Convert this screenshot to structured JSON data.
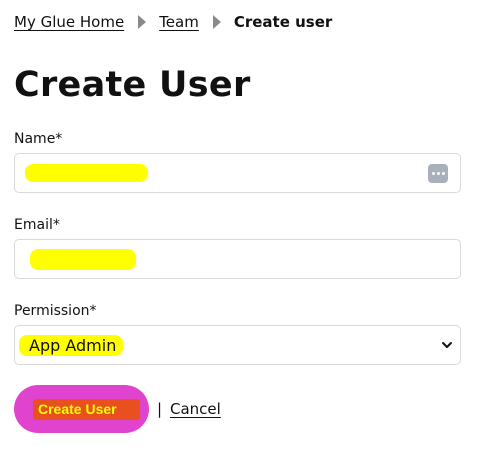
{
  "breadcrumb": {
    "home": "My Glue Home",
    "team": "Team",
    "current": "Create user"
  },
  "page": {
    "title": "Create User"
  },
  "form": {
    "name": {
      "label": "Name*",
      "value": ""
    },
    "email": {
      "label": "Email*",
      "value": ""
    },
    "permission": {
      "label": "Permission*",
      "selected": "App Admin"
    }
  },
  "actions": {
    "submit_label": "Create User",
    "separator": "|",
    "cancel_label": "Cancel"
  },
  "icons": {
    "breadcrumb_separator": "chevron-right-icon",
    "password_manager": "password-manager-icon",
    "select_chevron": "chevron-down-icon"
  },
  "colors": {
    "primary_button": "#e044cf",
    "highlight": "#ffff00",
    "input_border": "#d9d9d9"
  }
}
